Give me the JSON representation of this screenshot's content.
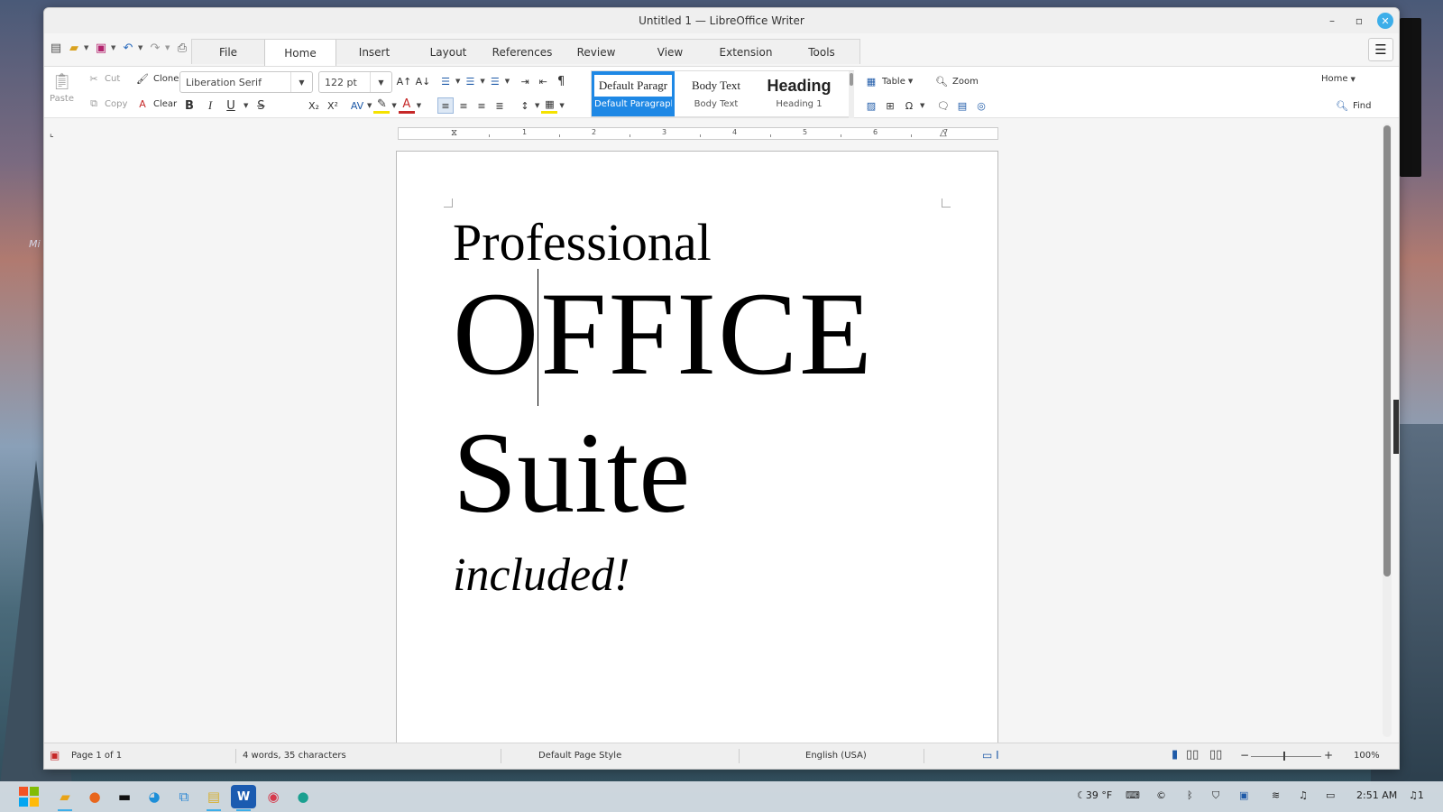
{
  "window": {
    "title": "Untitled 1 — LibreOffice Writer",
    "minimize_glyph": "–",
    "maximize_glyph": "▫",
    "close_glyph": "✕"
  },
  "tabs": [
    {
      "label": "File"
    },
    {
      "label": "Home"
    },
    {
      "label": "Insert"
    },
    {
      "label": "Layout"
    },
    {
      "label": "References"
    },
    {
      "label": "Review"
    },
    {
      "label": "View"
    },
    {
      "label": "Extension"
    },
    {
      "label": "Tools"
    }
  ],
  "active_tab": "Home",
  "ribbon": {
    "paste_label": "Paste",
    "cut_label": "Cut",
    "copy_label": "Copy",
    "clone_label": "Clone",
    "clear_label": "Clear",
    "font_name": "Liberation Serif",
    "font_size": "122 pt",
    "table_label": "Table",
    "zoom_label": "Zoom",
    "find_label": "Find",
    "home_select": "Home",
    "styles": [
      {
        "sample": "Default Paragr",
        "name": "Default Paragraph Style",
        "selected": true
      },
      {
        "sample": "Body Text",
        "name": "Body Text",
        "selected": false
      },
      {
        "sample": "Heading",
        "name": "Heading 1",
        "selected": false
      }
    ]
  },
  "ruler": {
    "numbers": [
      "1",
      "2",
      "3",
      "4",
      "5",
      "6",
      "7"
    ]
  },
  "document": {
    "lines": [
      {
        "text": "Professional"
      },
      {
        "text": "OFFICE"
      },
      {
        "text": "Suite"
      },
      {
        "text": "included!"
      }
    ]
  },
  "statusbar": {
    "page": "Page 1 of 1",
    "words": "4 words, 35 characters",
    "page_style": "Default Page Style",
    "language": "English (USA)",
    "zoom": "100%"
  },
  "taskbar": {
    "weather": "39 °F",
    "clock": "2:51 AM",
    "notifications": "1"
  },
  "colors": {
    "accent": "#1e88e5",
    "close": "#3daee9"
  }
}
